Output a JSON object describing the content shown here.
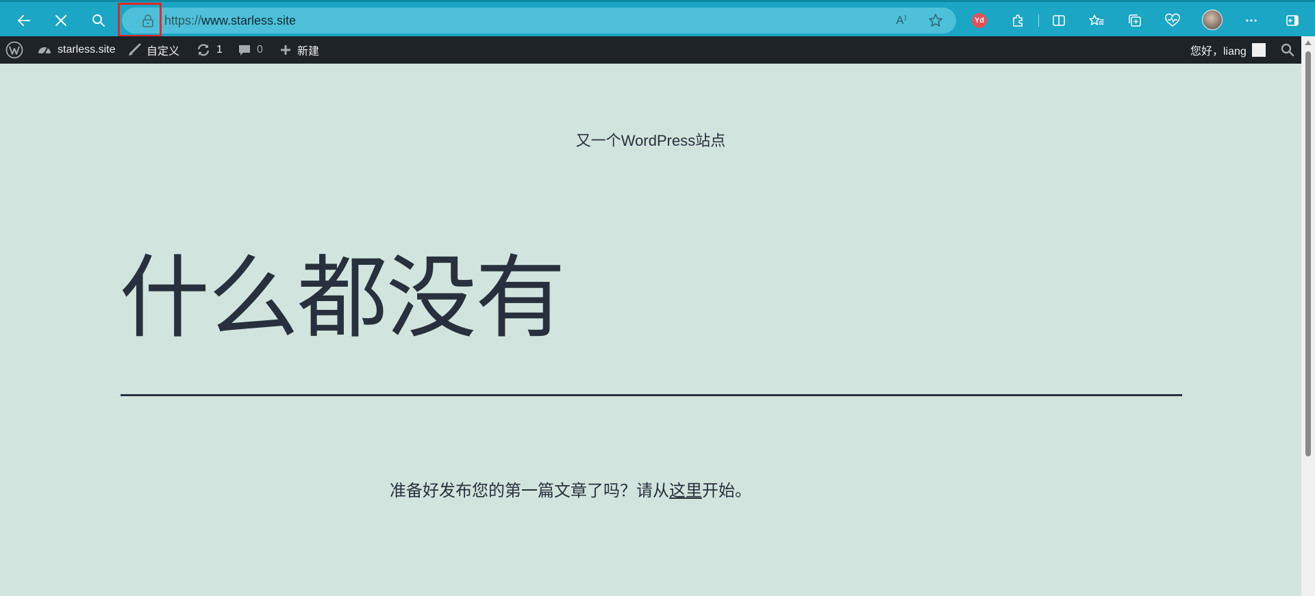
{
  "browser": {
    "url_scheme": "https://",
    "url_host": "www.starless.site",
    "read_aloud_label": "A⁾",
    "extension_badge": "Yd"
  },
  "wp_admin_bar": {
    "site_name": "starless.site",
    "customize_label": "自定义",
    "updates_count": "1",
    "comments_count": "0",
    "new_label": "新建",
    "greeting": "您好，liang"
  },
  "page": {
    "site_title": "又一个WordPress站点",
    "heading": "什么都没有",
    "lead_before": "准备好发布您的第一篇文章了吗？请从",
    "lead_link": "这里",
    "lead_after": "开始。"
  },
  "colors": {
    "browser_bar": "#1aa6c4",
    "address_bar": "#4ec0d9",
    "admin_bar": "#1d2327",
    "page_background": "#d1e4dd",
    "text": "#28303d",
    "highlight_box": "#e32626"
  }
}
